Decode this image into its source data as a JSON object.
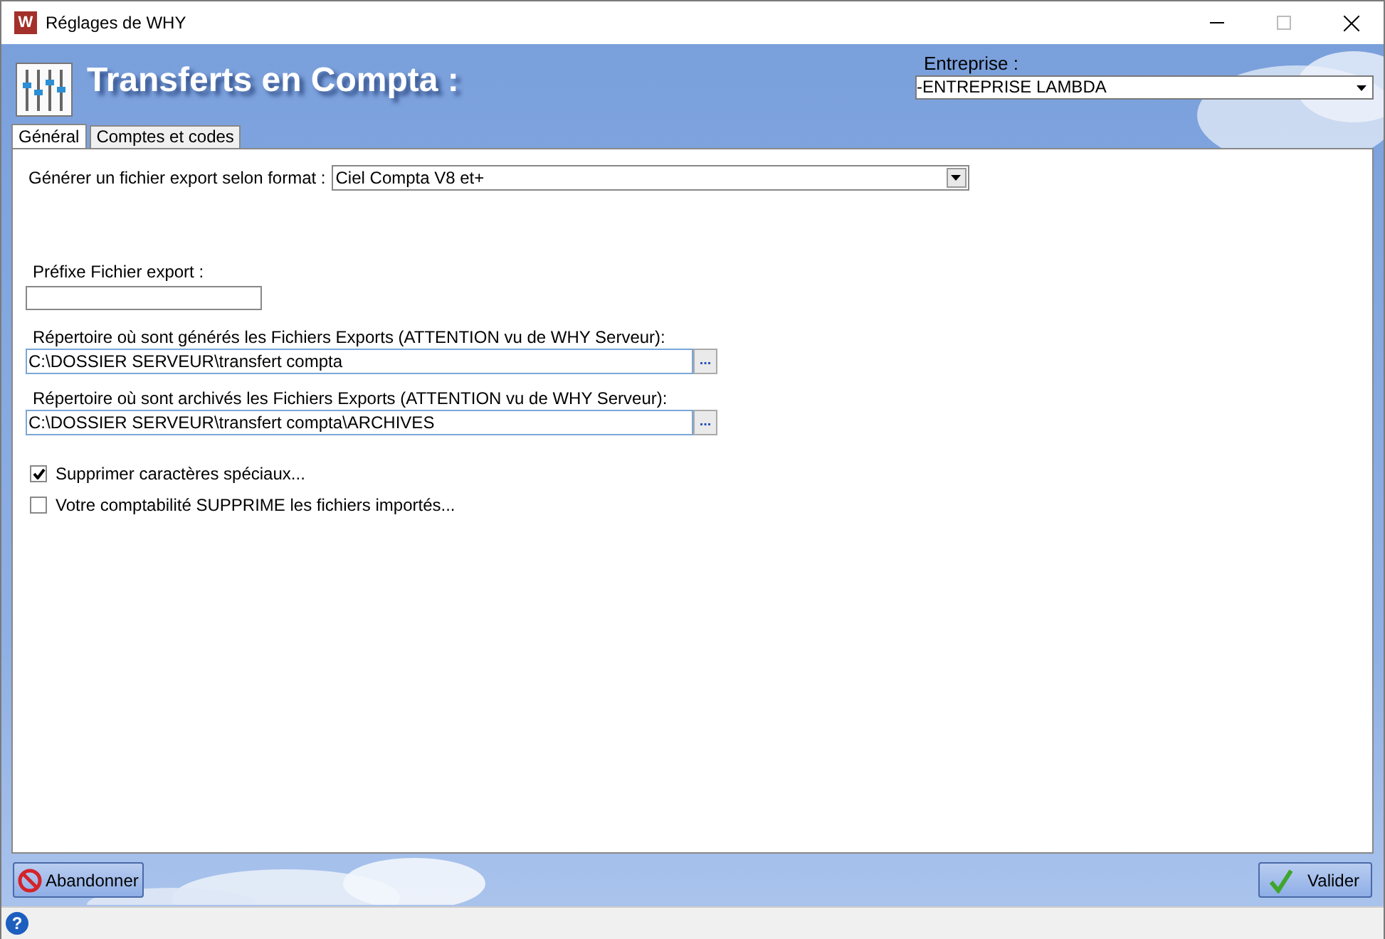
{
  "window": {
    "title": "Réglages de WHY",
    "app_icon_letter": "W"
  },
  "header": {
    "title": "Transferts en Compta :",
    "company_label": "Entreprise :",
    "company_value": "-ENTREPRISE LAMBDA"
  },
  "tabs": [
    {
      "label": "Général",
      "selected": true
    },
    {
      "label": "Comptes et codes",
      "selected": false
    }
  ],
  "format": {
    "label": "Générer un fichier export selon format :",
    "value": "Ciel Compta V8 et+"
  },
  "prefix": {
    "label": "Préfixe Fichier export :"
  },
  "directories": [
    {
      "label": "Répertoire où sont générés les Fichiers Exports (ATTENTION vu de WHY Serveur):",
      "value": "C:\\DOSSIER SERVEUR\\transfert compta",
      "browse": "..."
    },
    {
      "label": "Répertoire où sont archivés les Fichiers Exports (ATTENTION vu de WHY Serveur):",
      "value": "C:\\DOSSIER SERVEUR\\transfert compta\\ARCHIVES",
      "browse": "..."
    }
  ],
  "checkboxes": [
    {
      "label": "Supprimer caractères spéciaux...",
      "checked": true
    },
    {
      "label": "Votre comptabilité SUPPRIME les fichiers importés...",
      "checked": false
    }
  ],
  "buttons": {
    "cancel": "Abandonner",
    "ok": "Valider"
  },
  "status_bar": {
    "help": "?"
  }
}
